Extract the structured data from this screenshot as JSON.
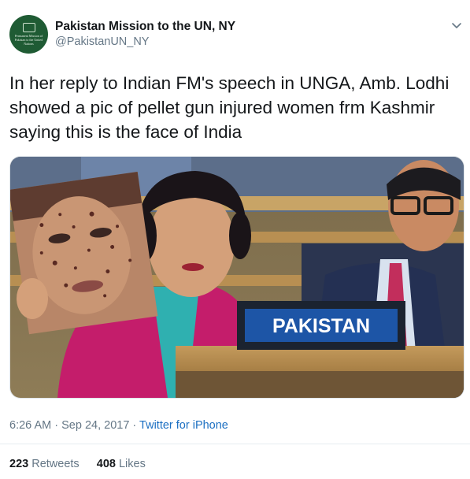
{
  "account": {
    "name": "Pakistan Mission to the UN, NY",
    "handle": "@PakistanUN_NY",
    "avatar_text": "Permanent Mission of Pakistan to the United Nations"
  },
  "tweet": {
    "text_lines": [
      "In her reply to Indian FM's speech in UNGA, Amb. Lodhi",
      "showed a pic of pellet gun injured women frm Kashmir",
      "saying this is the face of India"
    ],
    "media": {
      "nameplate": "PAKISTAN"
    },
    "time": "6:26 AM",
    "date": "Sep 24, 2017",
    "separator": "·",
    "source": "Twitter for iPhone"
  },
  "stats": {
    "retweets_count": "223",
    "retweets_label": "Retweets",
    "likes_count": "408",
    "likes_label": "Likes"
  },
  "colors": {
    "text": "#14171a",
    "secondary": "#657786",
    "link": "#1b6fc2",
    "avatar_bg": "#1f5b34"
  },
  "icons": [
    "chevron-down-icon"
  ]
}
